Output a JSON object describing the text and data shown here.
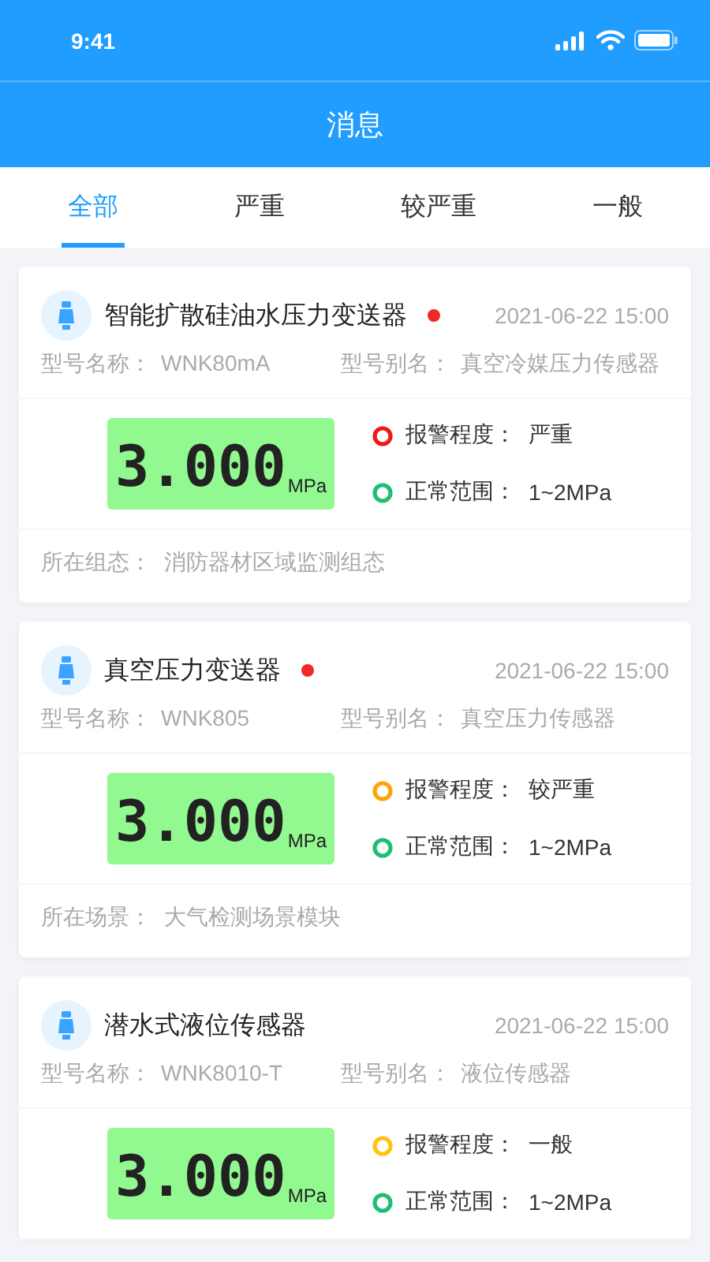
{
  "status_bar": {
    "time": "9:41"
  },
  "header": {
    "title": "消息"
  },
  "tabs": [
    {
      "label": "全部",
      "selected": true
    },
    {
      "label": "严重",
      "selected": false
    },
    {
      "label": "较严重",
      "selected": false
    },
    {
      "label": "一般",
      "selected": false
    }
  ],
  "messages": [
    {
      "name": "智能扩散硅油水压力变送器",
      "unread": true,
      "time": "2021-06-22 15:00",
      "model_label": "型号名称：",
      "model": "WNK80mA",
      "alias_label": "型号别名：",
      "alias": "真空冷媒压力传感器",
      "reading": "3.000",
      "unit": "MPa",
      "status": [
        {
          "label": "报警程度：",
          "value": "严重",
          "color": "#f01818"
        },
        {
          "label": "正常范围：",
          "value": "1~2MPa",
          "color": "#1dbf73"
        }
      ],
      "footer_label": "所在组态：",
      "footer": "消防器材区域监测组态"
    },
    {
      "name": "真空压力变送器",
      "unread": true,
      "time": "2021-06-22 15:00",
      "model_label": "型号名称：",
      "model": "WNK805",
      "alias_label": "型号别名：",
      "alias": "真空压力传感器",
      "reading": "3.000",
      "unit": "MPa",
      "status": [
        {
          "label": "报警程度：",
          "value": "较严重",
          "color": "#ffa20a"
        },
        {
          "label": "正常范围：",
          "value": "1~2MPa",
          "color": "#1dbf73"
        }
      ],
      "footer_label": "所在场景：",
      "footer": "大气检测场景模块"
    },
    {
      "name": "潜水式液位传感器",
      "unread": false,
      "time": "2021-06-22 15:00",
      "model_label": "型号名称：",
      "model": "WNK8010-T",
      "alias_label": "型号别名：",
      "alias": "液位传感器",
      "reading": "3.000",
      "unit": "MPa",
      "status": [
        {
          "label": "报警程度：",
          "value": "一般",
          "color": "#ffc20e"
        },
        {
          "label": "正常范围：",
          "value": "1~2MPa",
          "color": "#1dbf73"
        }
      ]
    }
  ]
}
